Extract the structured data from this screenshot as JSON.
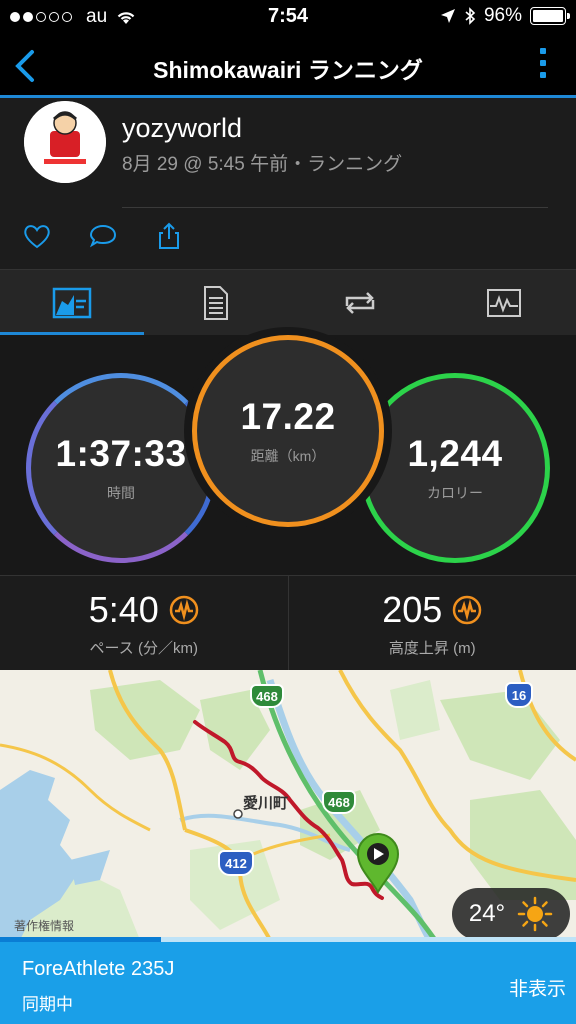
{
  "status_bar": {
    "carrier": "au",
    "time": "7:54",
    "battery": "96%"
  },
  "nav": {
    "title": "Shimokawairi ランニング"
  },
  "activity": {
    "user": "yozyworld",
    "meta": "8月 29 @ 5:45 午前・ランニング"
  },
  "stats": {
    "time": {
      "value": "1:37:33",
      "label": "時間"
    },
    "distance": {
      "value": "17.22",
      "label": "距離（km）"
    },
    "calories": {
      "value": "1,244",
      "label": "カロリー"
    },
    "pace": {
      "value": "5:40",
      "label": "ペース (分／km)"
    },
    "elevation": {
      "value": "205",
      "label": "高度上昇 (m)"
    }
  },
  "map": {
    "labels": {
      "town": "愛川町",
      "route_468_a": "468",
      "route_468_b": "468",
      "route_412": "412",
      "route_16": "16",
      "credit": "著作権情報"
    },
    "weather": {
      "temp": "24°"
    }
  },
  "sync": {
    "device": "ForeAthlete 235J",
    "status": "同期中",
    "hide_label": "非表示",
    "progress": 0.28
  },
  "colors": {
    "accent": "#1e88d6",
    "ring_time": "#6a6fd8",
    "ring_distance": "#f0901e",
    "ring_calories": "#2cd34a",
    "route": "#c0182a",
    "sync_banner": "#1a9fe8"
  }
}
